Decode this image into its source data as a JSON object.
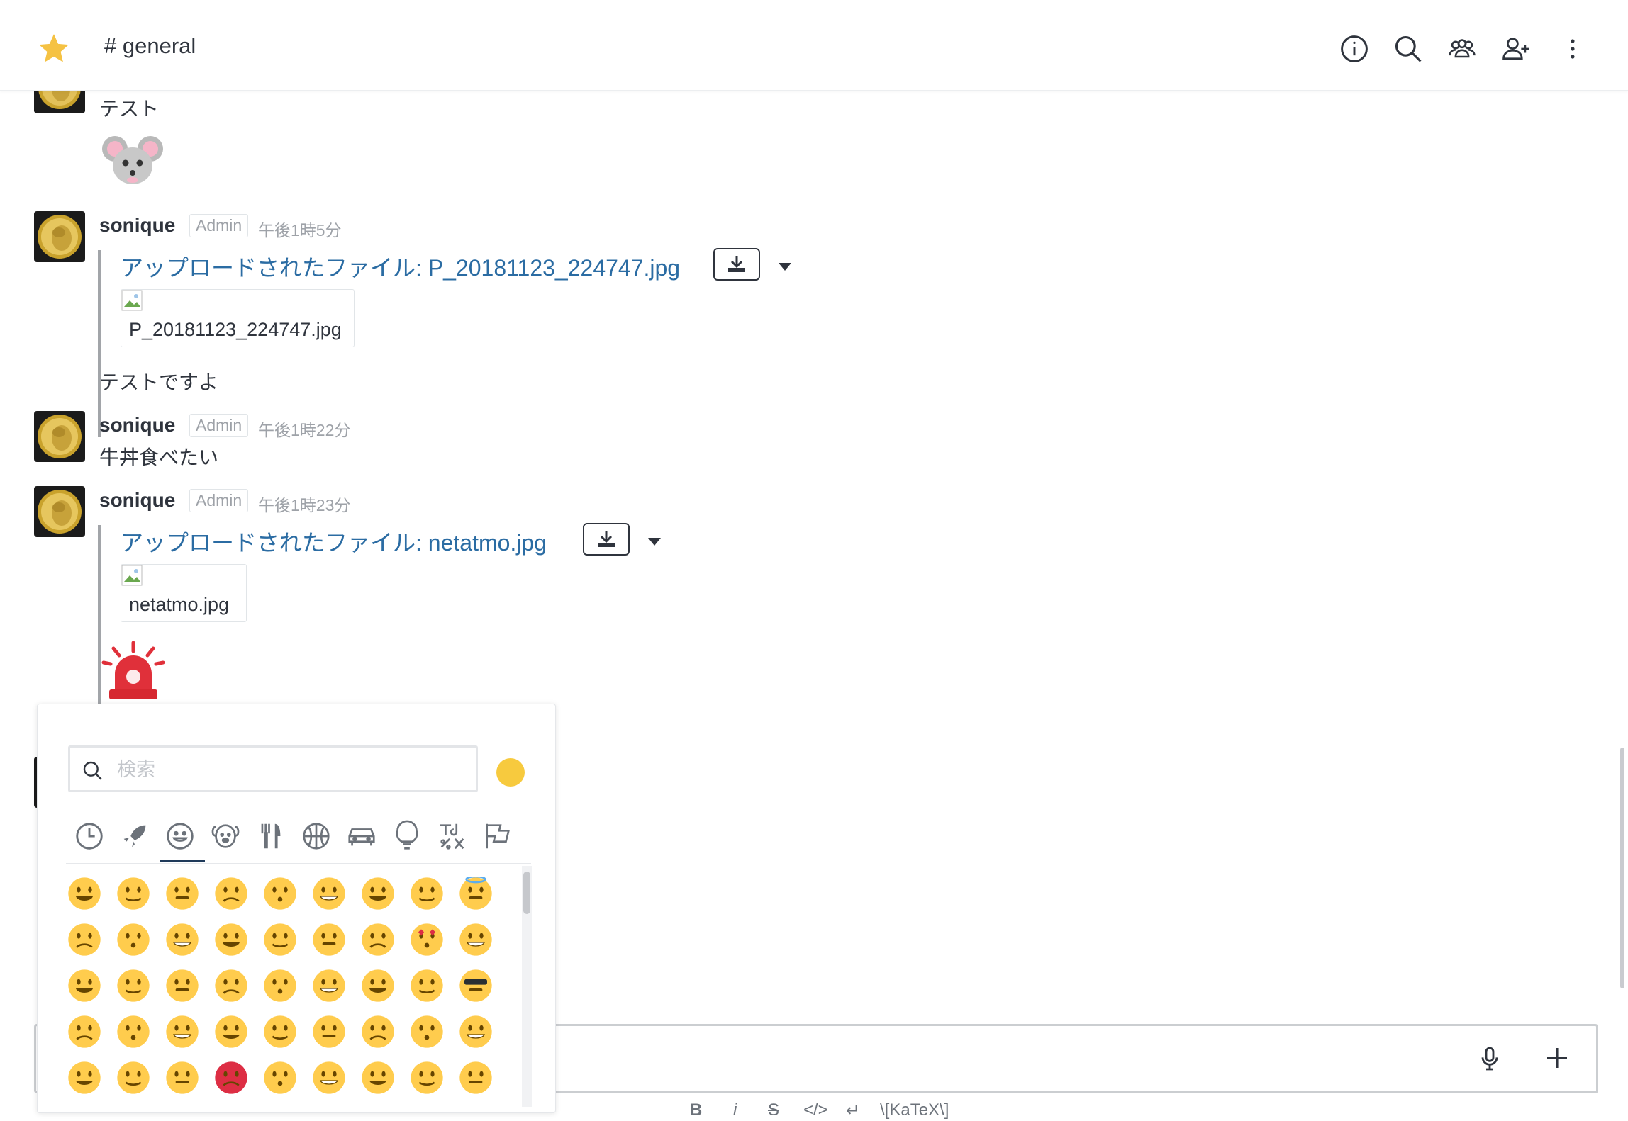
{
  "header": {
    "channel_title": "# general",
    "icons": [
      "star-icon",
      "info-icon",
      "search-icon",
      "members-icon",
      "add-user-icon",
      "kebab-menu-icon"
    ],
    "star_color": "#f5c243"
  },
  "messages": [
    {
      "text": "テスト",
      "emoji": "mouse-face"
    },
    {
      "user": "sonique",
      "role": "Admin",
      "time": "午後1時5分",
      "file_link": "アップロードされたファイル: P_20181123_224747.jpg",
      "image_name": "P_20181123_224747.jpg",
      "text_after": "テストですよ"
    },
    {
      "user": "sonique",
      "role": "Admin",
      "time": "午後1時22分",
      "text": "牛丼食べたい"
    },
    {
      "user": "sonique",
      "role": "Admin",
      "time": "午後1時23分",
      "file_link": "アップロードされたファイル: netatmo.jpg",
      "image_name": "netatmo.jpg",
      "emoji": "rotating-light"
    }
  ],
  "emoji_picker": {
    "search_placeholder": "検索",
    "tone_color": "#f7ca3e",
    "categories": [
      "recent",
      "travel",
      "people",
      "nature",
      "food",
      "activity",
      "places",
      "objects",
      "symbols",
      "flags"
    ],
    "active_category": "people",
    "rows": 5,
    "cols": 9
  },
  "composer": {
    "format_buttons": [
      "B",
      "i",
      "S",
      "</>",
      "↵",
      "\\[KaTeX\\]"
    ]
  }
}
